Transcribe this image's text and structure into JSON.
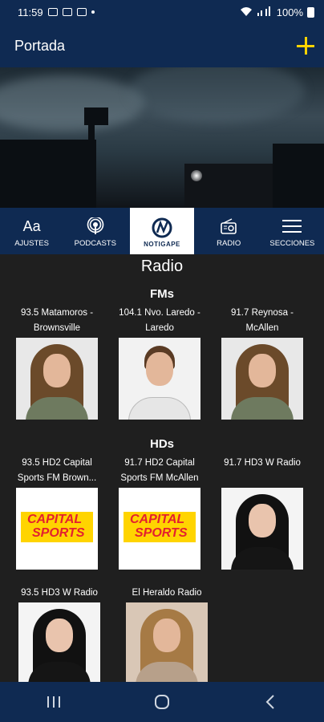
{
  "status": {
    "time": "11:59",
    "battery": "100%"
  },
  "appbar": {
    "title": "Portada",
    "plus_icon": "plus-icon"
  },
  "tabs": [
    {
      "label": "AJUSTES",
      "icon": "text-size-icon"
    },
    {
      "label": "PODCASTS",
      "icon": "podcast-icon"
    },
    {
      "label": "NOTIGAPE",
      "icon": "notigape-logo"
    },
    {
      "label": "RADIO",
      "icon": "radio-icon"
    },
    {
      "label": "SECCIONES",
      "icon": "list-icon"
    }
  ],
  "page": {
    "title": "Radio",
    "sections": [
      {
        "title": "FMs",
        "items": [
          {
            "label": "93.5 Matamoros - Brownsville"
          },
          {
            "label": "104.1 Nvo. Laredo - Laredo"
          },
          {
            "label": "91.7 Reynosa - McAllen"
          }
        ]
      },
      {
        "title": "HDs",
        "items": [
          {
            "label": "93.5 HD2 Capital Sports FM Brown..."
          },
          {
            "label": "91.7 HD2 Capital Sports FM McAllen"
          },
          {
            "label": "91.7 HD3 W Radio"
          },
          {
            "label": "93.5 HD3 W Radio"
          },
          {
            "label": "El Heraldo Radio"
          }
        ]
      }
    ]
  },
  "capital_text": "CAPITAL",
  "sports_text": "SPORTS",
  "colors": {
    "bar": "#0f2a52",
    "accent": "#ffd400",
    "background": "#1f1f1f"
  }
}
